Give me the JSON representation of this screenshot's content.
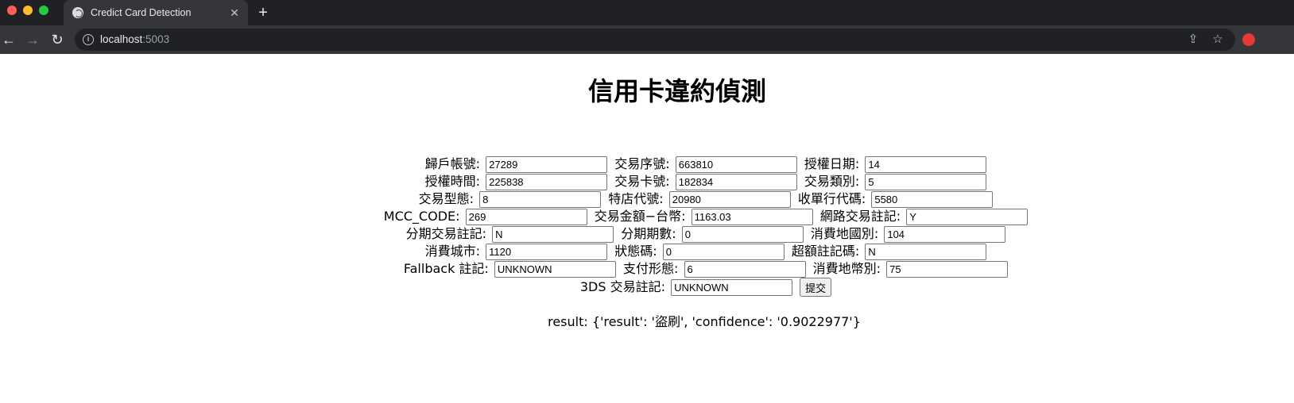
{
  "browser": {
    "tab_title": "Credict Card Detection",
    "url_host": "localhost",
    "url_port": ":5003"
  },
  "page": {
    "title": "信用卡違約偵測",
    "submit_label": "提交",
    "result_text": "result: {'result': '盜刷', 'confidence': '0.9022977'}"
  },
  "form_rows": [
    [
      {
        "label": "歸戶帳號:",
        "value": "27289"
      },
      {
        "label": "交易序號:",
        "value": "663810"
      },
      {
        "label": "授權日期:",
        "value": "14"
      }
    ],
    [
      {
        "label": "授權時間:",
        "value": "225838"
      },
      {
        "label": "交易卡號:",
        "value": "182834"
      },
      {
        "label": "交易類別:",
        "value": "5"
      }
    ],
    [
      {
        "label": "交易型態:",
        "value": "8"
      },
      {
        "label": "特店代號:",
        "value": "20980"
      },
      {
        "label": "收單行代碼:",
        "value": "5580"
      }
    ],
    [
      {
        "label": "MCC_CODE:",
        "value": "269"
      },
      {
        "label": "交易金額−台幣:",
        "value": "1163.03"
      },
      {
        "label": "網路交易註記:",
        "value": "Y"
      }
    ],
    [
      {
        "label": "分期交易註記:",
        "value": "N"
      },
      {
        "label": "分期期數:",
        "value": "0"
      },
      {
        "label": "消費地國別:",
        "value": "104"
      }
    ],
    [
      {
        "label": "消費城市:",
        "value": "1120"
      },
      {
        "label": "狀態碼:",
        "value": "0"
      },
      {
        "label": "超額註記碼:",
        "value": "N"
      }
    ],
    [
      {
        "label": "Fallback 註記:",
        "value": "UNKNOWN"
      },
      {
        "label": "支付形態:",
        "value": "6"
      },
      {
        "label": "消費地幣別:",
        "value": "75"
      }
    ],
    [
      {
        "label": "3DS 交易註記:",
        "value": "UNKNOWN"
      }
    ]
  ]
}
